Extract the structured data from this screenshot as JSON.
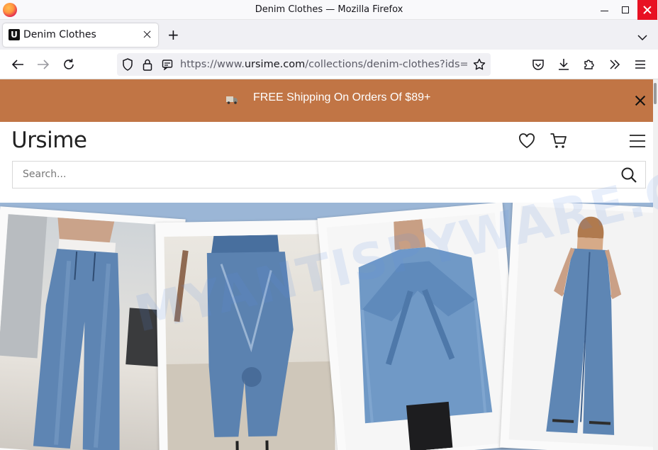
{
  "browser": {
    "window_title": "Denim Clothes — Mozilla Firefox",
    "tab": {
      "label": "Denim Clothes",
      "favicon": "U"
    },
    "url": {
      "prefix": "https://www.",
      "domain": "ursime.com",
      "path": "/collections/denim-clothes?ids=f"
    }
  },
  "promo": {
    "text": "FREE Shipping On Orders Of $89+",
    "bg_color": "#c17545"
  },
  "site": {
    "logo": "Ursime",
    "search_placeholder": "Search..."
  },
  "watermark": "MYANTISPYWARE.COM",
  "colors": {
    "accent": "#c17545",
    "banner_bg": "#9bb6d6",
    "close_red": "#e81123"
  },
  "banner": {
    "cards": [
      {
        "name": "wide-leg-jeans"
      },
      {
        "name": "patchwork-jeans"
      },
      {
        "name": "bow-denim-jacket"
      },
      {
        "name": "denim-jumpsuit"
      }
    ]
  }
}
